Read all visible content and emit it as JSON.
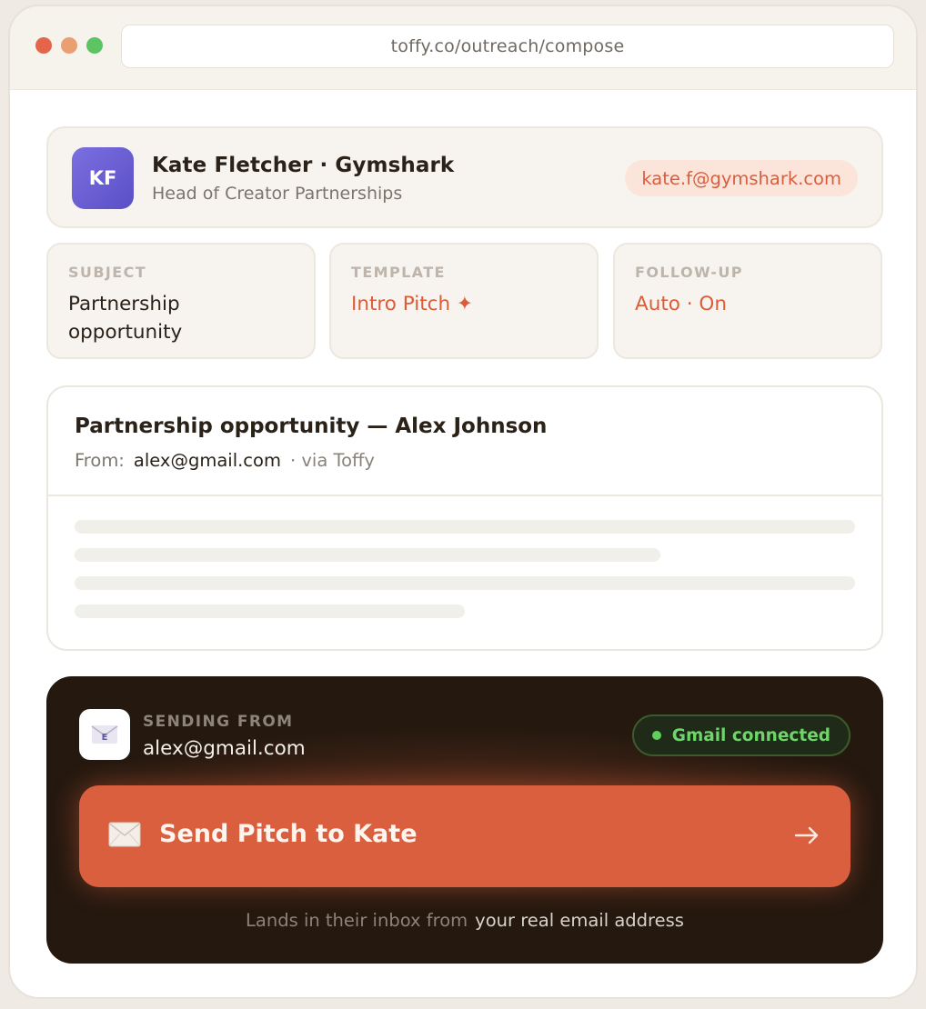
{
  "browser": {
    "url": "toffy.co/outreach/compose"
  },
  "contact": {
    "initials": "KF",
    "name": "Kate Fletcher · Gymshark",
    "role": "Head of Creator Partnerships",
    "email": "kate.f@gymshark.com"
  },
  "meta": {
    "subject_label": "SUBJECT",
    "subject_value": "Partnership opportunity",
    "template_label": "TEMPLATE",
    "template_value": "Intro Pitch ✦",
    "followup_label": "FOLLOW-UP",
    "followup_value": "Auto · On"
  },
  "email": {
    "subject": "Partnership opportunity — Alex Johnson",
    "from_label": "From:",
    "from_address": "alex@gmail.com",
    "via": "· via Toffy"
  },
  "sender": {
    "label": "SENDING FROM",
    "address": "alex@gmail.com",
    "status": "Gmail connected",
    "tile_letter": "E"
  },
  "send_button": {
    "label": "Send Pitch to Kate",
    "arrow": "→"
  },
  "footnote": {
    "prefix": "Lands in their inbox from",
    "emphasis": "your real email address"
  },
  "colors": {
    "accent": "#da5f3f",
    "panel": "#24180f",
    "connected": "#6fd56b"
  }
}
